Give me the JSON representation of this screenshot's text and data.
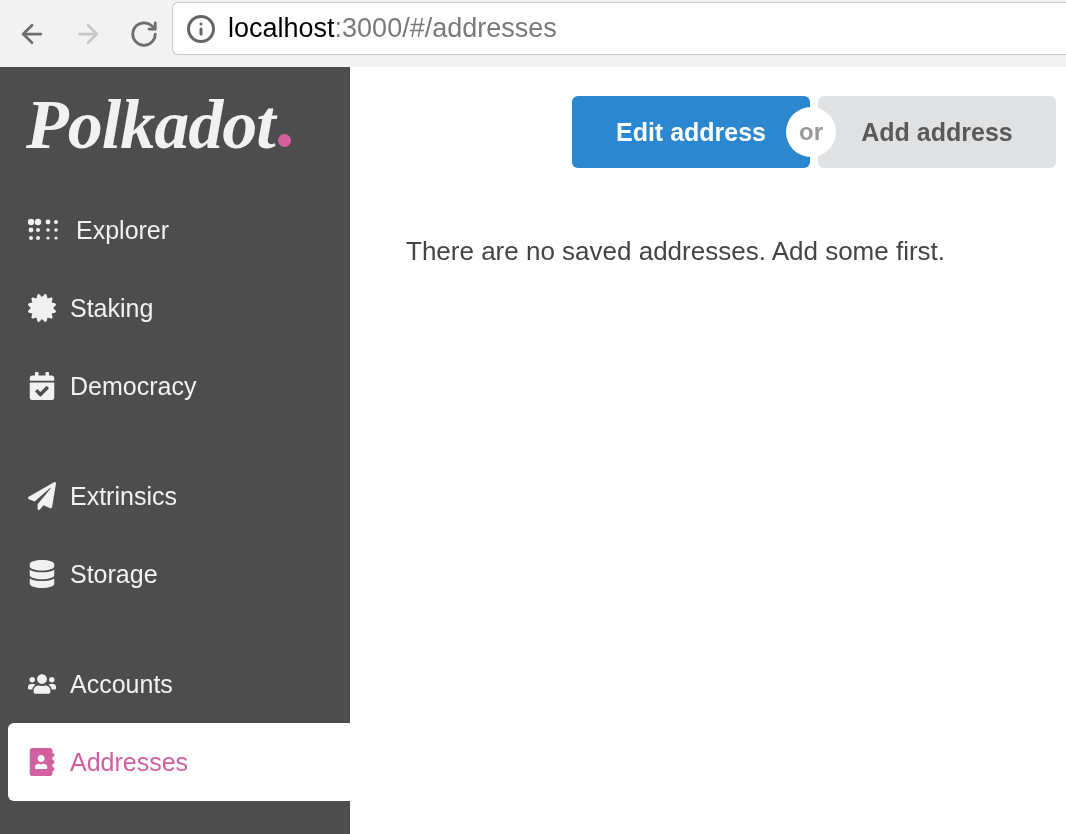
{
  "browser": {
    "nav_buttons": [
      {
        "kind": "back",
        "disabled": false
      },
      {
        "kind": "forward",
        "disabled": true
      },
      {
        "kind": "reload",
        "disabled": false
      }
    ],
    "address_bar": {
      "host": "localhost",
      "path": ":3000/#/addresses"
    }
  },
  "sidebar": {
    "logo": "Polkadot",
    "groups": [
      {
        "items": [
          {
            "label": "Explorer",
            "selected": false
          },
          {
            "label": "Staking",
            "selected": false
          },
          {
            "label": "Democracy",
            "selected": false
          }
        ]
      },
      {
        "items": [
          {
            "label": "Extrinsics",
            "selected": false
          },
          {
            "label": "Storage",
            "selected": false
          }
        ]
      },
      {
        "items": [
          {
            "label": "Accounts",
            "selected": false
          },
          {
            "label": "Addresses",
            "selected": true
          }
        ]
      }
    ]
  },
  "toolbar": {
    "buttons": [
      {
        "label": "Edit address",
        "primary": true
      },
      {
        "label": "Add address",
        "primary": false
      }
    ],
    "separator": "or"
  },
  "empty_message": "There are no saved addresses. Add some first."
}
